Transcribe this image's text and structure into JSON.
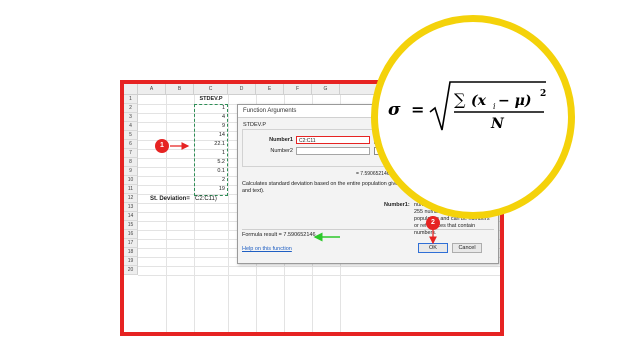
{
  "sheet": {
    "columns": [
      "A",
      "B",
      "C",
      "D",
      "E",
      "F",
      "G",
      "H"
    ],
    "rows": [
      "1",
      "2",
      "3",
      "4",
      "5",
      "6",
      "7",
      "8",
      "9",
      "10",
      "11",
      "12",
      "13",
      "14",
      "15",
      "16",
      "17",
      "18",
      "19",
      "20"
    ],
    "header_c1": "STDEV.P",
    "values": [
      "1",
      "4",
      "9",
      "14",
      "22.1",
      "1",
      "5.2",
      "0.1",
      "2",
      "19"
    ],
    "label_b12": "St. Deviation=",
    "formula_c12": "C2:C11)"
  },
  "dialog": {
    "title": "Function Arguments",
    "function_name": "STDEV.P",
    "number1_label": "Number1",
    "number1_value": "C2:C11",
    "number2_label": "Number2",
    "result_value": "= 7.590652146",
    "description": "Calculates standard deviation based on the entire population given as arguments (ignores logical values and text).",
    "param_name": "Number1:",
    "param_desc": "number1,number2,... are 1 to 255 numbers corresponding to a population and can be numbers or references that contain numbers.",
    "formula_result": "Formula result =   7.590652146",
    "help_link": "Help on this function",
    "ok_label": "OK",
    "cancel_label": "Cancel"
  },
  "formula": {
    "sigma": "σ",
    "equals": "=",
    "sum": "∑",
    "term": "(x",
    "sub_i": "i",
    "minus_mu": " − μ)",
    "exp": "2",
    "denominator": "N"
  },
  "annotations": {
    "badge1": "1",
    "badge2": "2"
  },
  "colors": {
    "frame_red": "#e62322",
    "circle_yellow": "#f4d20a",
    "arrow_green": "#2cc82a",
    "link_blue": "#1f5fc3"
  }
}
